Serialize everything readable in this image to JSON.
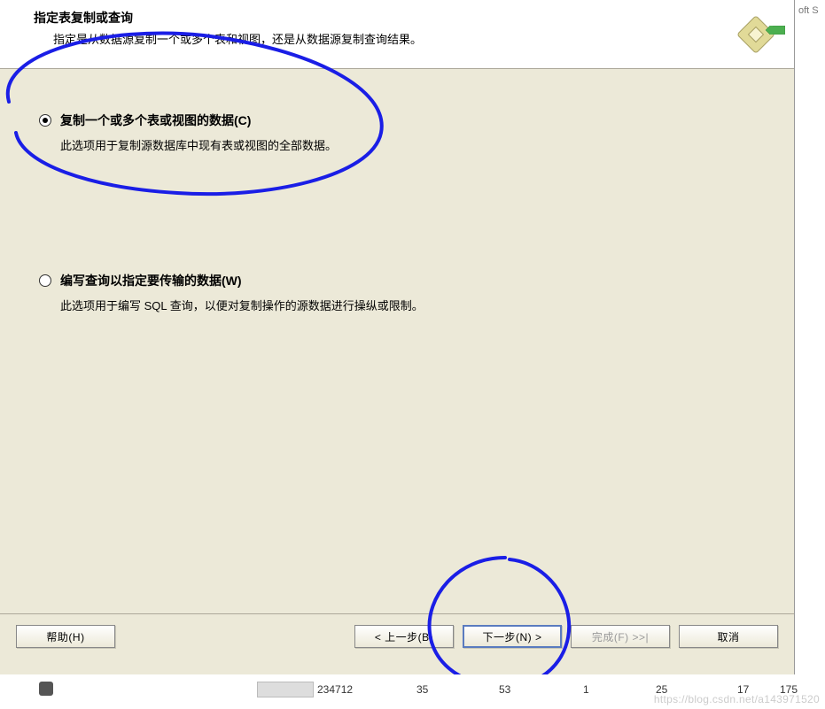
{
  "header": {
    "title": "指定表复制或查询",
    "subtitle": "指定是从数据源复制一个或多个表和视图，还是从数据源复制查询结果。"
  },
  "options": {
    "copy": {
      "label": "复制一个或多个表或视图的数据(C)",
      "desc": "此选项用于复制源数据库中现有表或视图的全部数据。",
      "selected": true
    },
    "query": {
      "label": "编写查询以指定要传输的数据(W)",
      "desc": "此选项用于编写 SQL 查询，以便对复制操作的源数据进行操纵或限制。",
      "selected": false
    }
  },
  "footer": {
    "help": "帮助(H)",
    "back": "< 上一步(B)",
    "next": "下一步(N) >",
    "finish": "完成(F) >>|",
    "cancel": "取消"
  },
  "right_strip": {
    "partial_text": "oft S"
  },
  "bottom": {
    "cells": [
      "234712",
      "35",
      "53",
      "1",
      "25",
      "17",
      "175"
    ],
    "watermark": "https://blog.csdn.net/a143971520"
  }
}
